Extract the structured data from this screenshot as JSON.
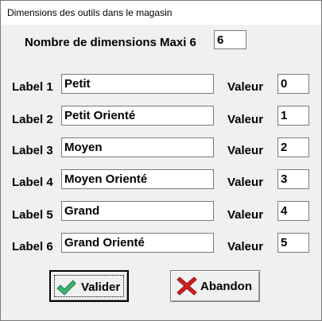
{
  "window": {
    "title": "Dimensions des outils dans le magasin"
  },
  "max_dimensions": {
    "label": "Nombre de dimensions Maxi 6",
    "value": "6"
  },
  "value_caption": "Valeur",
  "rows": [
    {
      "label": "Label 1",
      "name": "Petit",
      "value": "0"
    },
    {
      "label": "Label 2",
      "name": "Petit Orienté",
      "value": "1"
    },
    {
      "label": "Label 3",
      "name": "Moyen",
      "value": "2"
    },
    {
      "label": "Label 4",
      "name": "Moyen Orienté",
      "value": "3"
    },
    {
      "label": "Label 5",
      "name": "Grand",
      "value": "4"
    },
    {
      "label": "Label 6",
      "name": "Grand Orienté",
      "value": "5"
    }
  ],
  "buttons": {
    "ok_label": "Valider",
    "ok_icon": "checkmark-icon",
    "cancel_label": "Abandon",
    "cancel_icon": "red-x-icon"
  },
  "colors": {
    "ok_icon": "#3cb371",
    "cancel_icon": "#d62020"
  }
}
